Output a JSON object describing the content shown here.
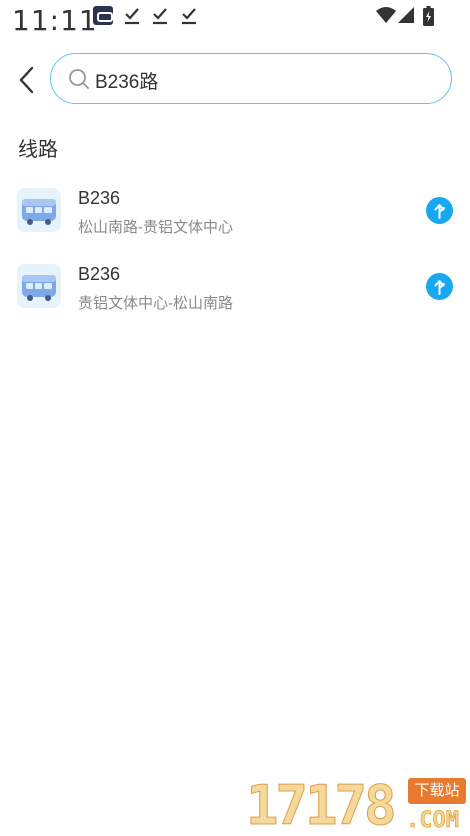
{
  "status_bar": {
    "time": "11:11",
    "icons": [
      "app-notification-icon",
      "download-done-icon",
      "download-done-icon",
      "download-done-icon",
      "wifi-icon",
      "cell-signal-icon",
      "battery-charging-icon"
    ]
  },
  "header": {
    "back_icon": "chevron-left-icon",
    "search_icon": "search-icon",
    "search_value": "B236路"
  },
  "section": {
    "title": "线路"
  },
  "routes": [
    {
      "name": "B236",
      "desc": "松山南路-贵铝文体中心",
      "icon": "bus-icon",
      "action_icon": "direction-arrow-icon"
    },
    {
      "name": "B236",
      "desc": "贵铝文体中心-松山南路",
      "icon": "bus-icon",
      "action_icon": "direction-arrow-icon"
    }
  ],
  "watermark": {
    "digits": "17178",
    "badge": "下载站",
    "domain": ".COM"
  },
  "colors": {
    "accent": "#1aa7f2",
    "search_border": "#5cc6ef",
    "text": "#333333",
    "subtext": "#8a8a8a"
  }
}
